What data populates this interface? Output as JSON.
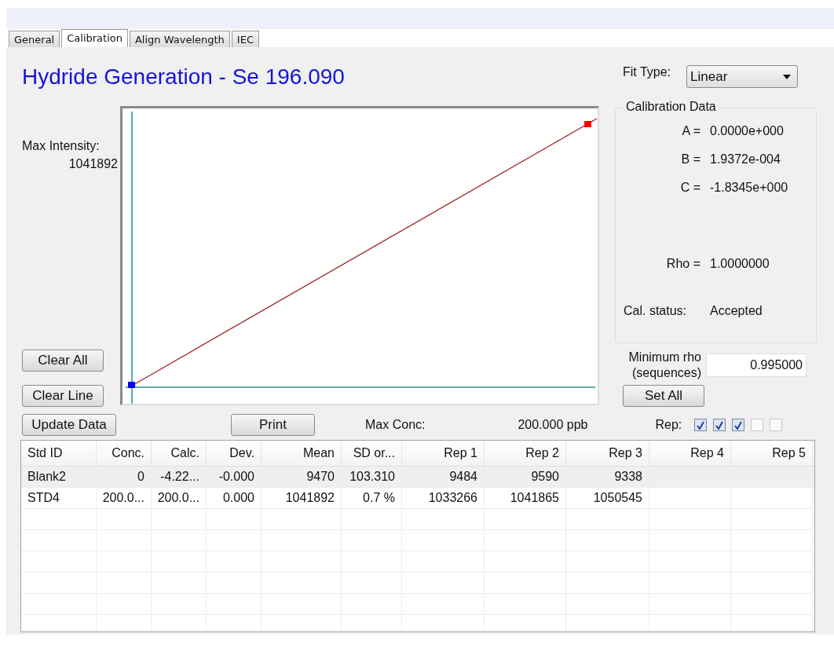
{
  "tabs": [
    {
      "label": "General",
      "selected": false
    },
    {
      "label": "Calibration",
      "selected": true
    },
    {
      "label": "Align Wavelength",
      "selected": false
    },
    {
      "label": "IEC",
      "selected": false
    }
  ],
  "title": "Hydride Generation - Se 196.090",
  "max_intensity": {
    "label": "Max Intensity:",
    "value": "1041892"
  },
  "chart": {
    "points": [
      {
        "color": "#0000ff"
      },
      {
        "color": "#ff0000"
      }
    ]
  },
  "left_buttons": [
    "Clear All",
    "Clear Line"
  ],
  "fit_type": {
    "label": "Fit Type:",
    "value": "Linear"
  },
  "calibration_data": {
    "title": "Calibration Data",
    "coefficients": [
      {
        "label": "A =",
        "value": "0.0000e+000"
      },
      {
        "label": "B =",
        "value": "1.9372e-004"
      },
      {
        "label": "C =",
        "value": "-1.8345e+000"
      }
    ],
    "rho": {
      "label": "Rho =",
      "value": "1.0000000"
    },
    "status": {
      "label": "Cal. status:",
      "value": "Accepted"
    }
  },
  "minimum_rho": {
    "label": "Minimum rho (sequences)",
    "value": "0.995000"
  },
  "set_all_button": "Set All",
  "update_button": "Update Data",
  "print_button": "Print",
  "max_conc": {
    "label": "Max Conc:",
    "value": "200.000 ppb"
  },
  "rep_label": "Rep:",
  "rep_checks": [
    {
      "checked": true
    },
    {
      "checked": true
    },
    {
      "checked": true
    },
    {
      "checked": false
    },
    {
      "checked": false
    }
  ],
  "table": {
    "columns": [
      "Std ID",
      "Conc.",
      "Calc.",
      "Dev.",
      "Mean",
      "SD or...",
      "Rep 1",
      "Rep 2",
      "Rep 3",
      "Rep 4",
      "Rep 5"
    ],
    "rows": [
      {
        "selected": true,
        "cells": [
          "Blank2",
          "0",
          "-4.22...",
          "-0.000",
          "9470",
          "103.310",
          "9484",
          "9590",
          "9338",
          "",
          ""
        ]
      },
      {
        "selected": false,
        "cells": [
          "STD4",
          "200.0...",
          "200.0...",
          "0.000",
          "1041892",
          "0.7 %",
          "1033266",
          "1041865",
          "1050545",
          "",
          ""
        ]
      }
    ]
  }
}
